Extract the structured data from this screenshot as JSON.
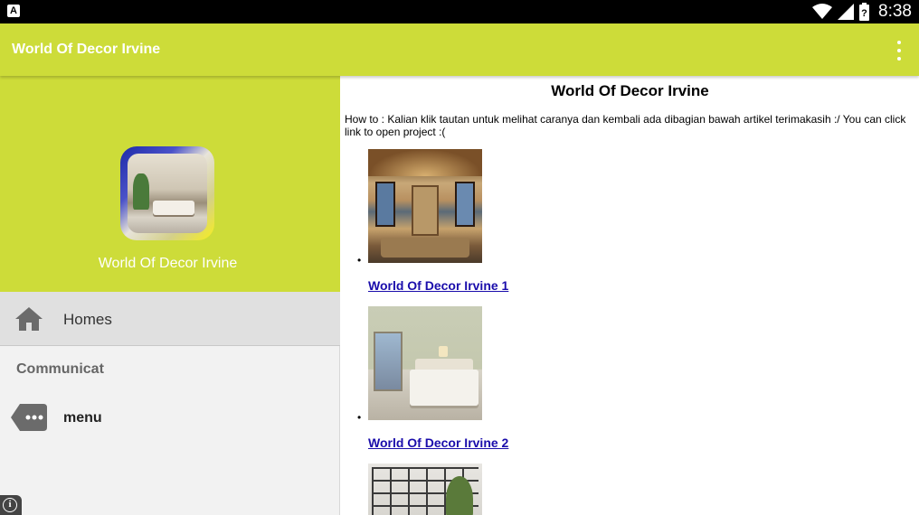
{
  "status_bar": {
    "time": "8:38",
    "left_icon": "A",
    "icons": [
      "wifi-icon",
      "signal-icon",
      "battery-icon"
    ]
  },
  "app_bar": {
    "title": "World Of Decor Irvine",
    "overflow_icon": "more-vert-icon"
  },
  "drawer": {
    "header_title": "World Of Decor Irvine",
    "items": [
      {
        "label": "Homes",
        "icon": "home-icon",
        "selected": true
      }
    ],
    "section_header": "Communicat",
    "section_items": [
      {
        "label": "menu",
        "icon": "more-tag-icon"
      }
    ]
  },
  "content": {
    "title": "World Of Decor Irvine",
    "howto": "How to : Kalian klik tautan untuk melihat caranya dan kembali ada dibagian bawah artikel terimakasih :/ You can click link to open project :(",
    "items": [
      {
        "link": "World Of Decor Irvine 1"
      },
      {
        "link": "World Of Decor Irvine 2"
      },
      {
        "link": ""
      }
    ]
  },
  "colors": {
    "accent": "#cddc39",
    "status_bar": "#000000",
    "link": "#1a0dab",
    "drawer_bg": "#f2f2f2",
    "selected_bg": "#e0e0e0"
  }
}
